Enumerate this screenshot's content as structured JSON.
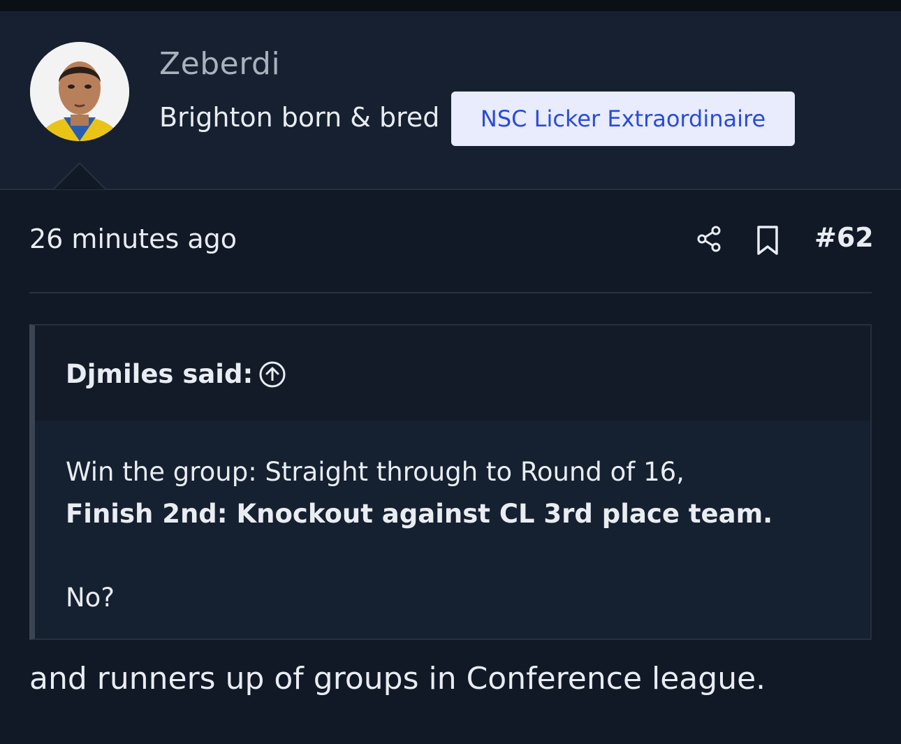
{
  "user": {
    "name": "Zeberdi",
    "title": "Brighton born & bred",
    "banner": "NSC Licker Extraordinaire"
  },
  "post": {
    "time": "26 minutes ago",
    "number": "#62",
    "icons": [
      "share-icon",
      "bookmark-icon"
    ]
  },
  "quote": {
    "author_label": "Djmiles said:",
    "line1": "Win the group: Straight through to Round of 16,",
    "line2": "Finish 2nd: Knockout against CL 3rd place team.",
    "line3": "No?"
  },
  "reply": {
    "text": "and runners up of groups in Conference league."
  },
  "colors": {
    "background": "#111927",
    "header_bg": "#162030",
    "banner_bg": "#e8ecfd",
    "banner_text": "#2a4bd7",
    "quote_border": "#3a4452"
  }
}
